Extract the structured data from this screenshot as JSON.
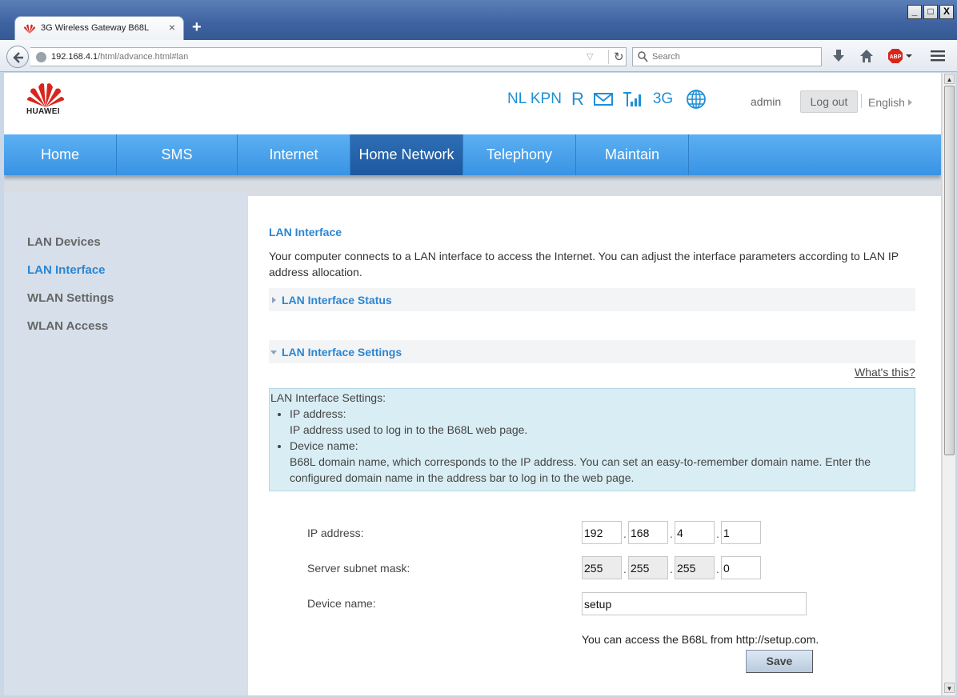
{
  "browser": {
    "tab_title": "3G Wireless Gateway B68L",
    "tab_close": "×",
    "new_tab": "+",
    "url_host": "192.168.4.1",
    "url_path": "/html/advance.html#lan",
    "search_placeholder": "Search",
    "window_buttons": [
      "_",
      "□",
      "X"
    ]
  },
  "header": {
    "brand": "HUAWEI",
    "operator": "NL KPN",
    "roaming": "R",
    "network_type": "3G",
    "user": "admin",
    "logout_label": "Log out",
    "language": "English"
  },
  "nav": {
    "items": [
      "Home",
      "SMS",
      "Internet",
      "Home Network",
      "Telephony",
      "Maintain"
    ],
    "active": "Home Network"
  },
  "sidebar": {
    "items": [
      "LAN Devices",
      "LAN Interface",
      "WLAN Settings",
      "WLAN Access"
    ],
    "active": "LAN Interface"
  },
  "content": {
    "title": "LAN Interface",
    "description": "Your computer connects to a LAN interface to access the Internet. You can adjust the interface parameters according to LAN IP address allocation.",
    "section_status": "LAN Interface Status",
    "section_settings": "LAN Interface Settings",
    "whats_this": "What's this?",
    "help": {
      "heading": "LAN Interface Settings:",
      "items": [
        {
          "term": "IP address:",
          "detail": "IP address used to log in to the B68L web page."
        },
        {
          "term": "Device name:",
          "detail": "B68L domain name, which corresponds to the IP address. You can set an easy-to-remember domain name. Enter the configured domain name in the address bar to log in to the web page."
        }
      ]
    },
    "form": {
      "ip_label": "IP address:",
      "ip": [
        "192",
        "168",
        "4",
        "1"
      ],
      "mask_label": "Server subnet mask:",
      "mask": [
        "255",
        "255",
        "255",
        "0"
      ],
      "device_label": "Device name:",
      "device_name": "setup",
      "access_note": "You can access the B68L from http://setup.com.",
      "dot": ".",
      "save_label": "Save"
    }
  },
  "colors": {
    "accent": "#2a86d4",
    "nav_bg": "#3993e4",
    "nav_active": "#1d58a0",
    "sidebar_bg": "#d6dfea",
    "help_bg": "#d9eef4"
  }
}
